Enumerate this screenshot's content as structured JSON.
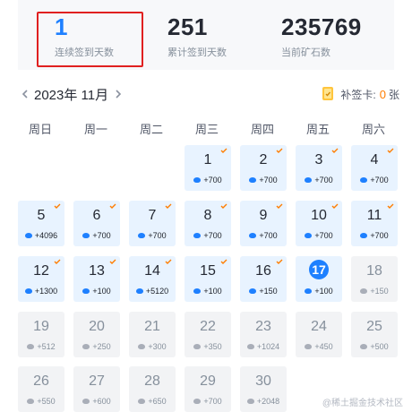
{
  "stats": [
    {
      "value": "1",
      "label": "连续签到天数"
    },
    {
      "value": "251",
      "label": "累计签到天数"
    },
    {
      "value": "235769",
      "label": "当前矿石数"
    }
  ],
  "calendar": {
    "title": "2023年 11月",
    "makeup_label": "补签卡:",
    "makeup_count": "0",
    "makeup_unit": "张",
    "weekdays": [
      "周日",
      "周一",
      "周二",
      "周三",
      "周四",
      "周五",
      "周六"
    ],
    "days": [
      {
        "day": "1",
        "reward": "+700",
        "status": "signed"
      },
      {
        "day": "2",
        "reward": "+700",
        "status": "signed"
      },
      {
        "day": "3",
        "reward": "+700",
        "status": "signed"
      },
      {
        "day": "4",
        "reward": "+700",
        "status": "signed"
      },
      {
        "day": "5",
        "reward": "+4096",
        "status": "signed"
      },
      {
        "day": "6",
        "reward": "+700",
        "status": "signed"
      },
      {
        "day": "7",
        "reward": "+700",
        "status": "signed"
      },
      {
        "day": "8",
        "reward": "+700",
        "status": "signed"
      },
      {
        "day": "9",
        "reward": "+700",
        "status": "signed"
      },
      {
        "day": "10",
        "reward": "+700",
        "status": "signed"
      },
      {
        "day": "11",
        "reward": "+700",
        "status": "signed"
      },
      {
        "day": "12",
        "reward": "+1300",
        "status": "signed"
      },
      {
        "day": "13",
        "reward": "+100",
        "status": "signed"
      },
      {
        "day": "14",
        "reward": "+5120",
        "status": "signed"
      },
      {
        "day": "15",
        "reward": "+100",
        "status": "signed"
      },
      {
        "day": "16",
        "reward": "+150",
        "status": "signed"
      },
      {
        "day": "17",
        "reward": "+100",
        "status": "today"
      },
      {
        "day": "18",
        "reward": "+150",
        "status": "pending"
      },
      {
        "day": "19",
        "reward": "+512",
        "status": "pending"
      },
      {
        "day": "20",
        "reward": "+250",
        "status": "pending"
      },
      {
        "day": "21",
        "reward": "+300",
        "status": "pending"
      },
      {
        "day": "22",
        "reward": "+350",
        "status": "pending"
      },
      {
        "day": "23",
        "reward": "+1024",
        "status": "pending"
      },
      {
        "day": "24",
        "reward": "+450",
        "status": "pending"
      },
      {
        "day": "25",
        "reward": "+500",
        "status": "pending"
      },
      {
        "day": "26",
        "reward": "+550",
        "status": "pending"
      },
      {
        "day": "27",
        "reward": "+600",
        "status": "pending"
      },
      {
        "day": "28",
        "reward": "+650",
        "status": "pending"
      },
      {
        "day": "29",
        "reward": "+700",
        "status": "pending"
      },
      {
        "day": "30",
        "reward": "+2048",
        "status": "pending"
      }
    ]
  },
  "watermark": "@稀土掘金技术社区",
  "colors": {
    "accent": "#1e80ff",
    "check": "#ff7d00",
    "highlight": "#e02020"
  }
}
